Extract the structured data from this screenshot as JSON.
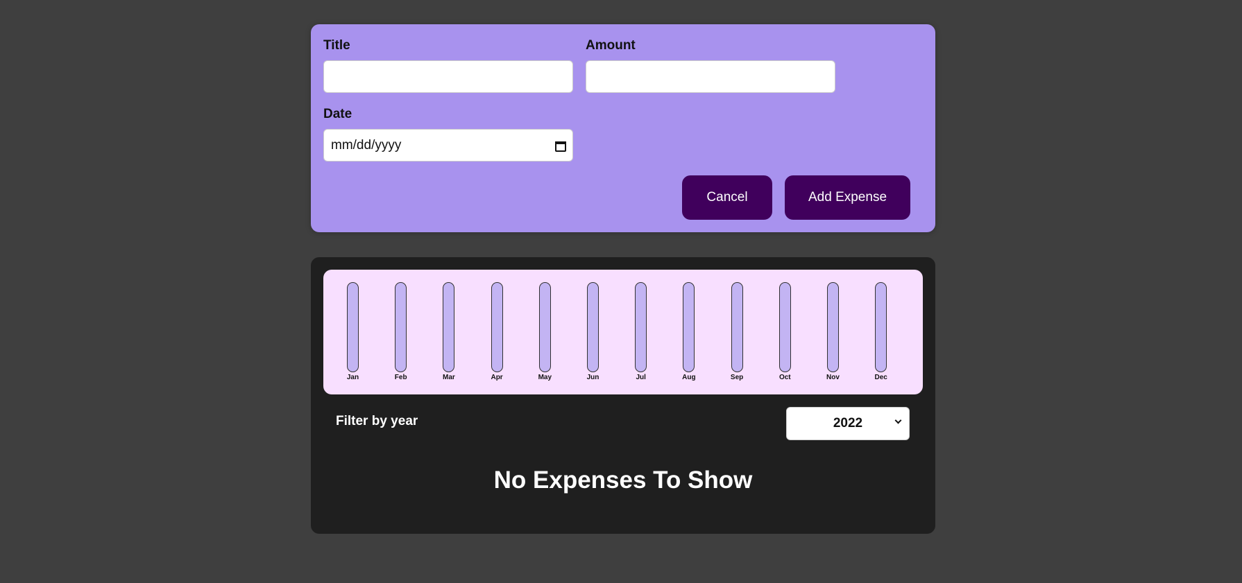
{
  "form": {
    "title_label": "Title",
    "title_value": "",
    "amount_label": "Amount",
    "amount_value": "",
    "date_label": "Date",
    "date_placeholder": "mm/dd/yyyy",
    "cancel_label": "Cancel",
    "add_label": "Add Expense"
  },
  "chart_data": {
    "type": "bar",
    "categories": [
      "Jan",
      "Feb",
      "Mar",
      "Apr",
      "May",
      "Jun",
      "Jul",
      "Aug",
      "Sep",
      "Oct",
      "Nov",
      "Dec"
    ],
    "values": [
      0,
      0,
      0,
      0,
      0,
      0,
      0,
      0,
      0,
      0,
      0,
      0
    ]
  },
  "filter": {
    "label": "Filter by year",
    "selected_year": "2022"
  },
  "expenses": {
    "empty_message": "No Expenses To Show"
  },
  "colors": {
    "page_bg": "#3f3f3f",
    "form_bg": "#a892ee",
    "button_bg": "#40005c",
    "card_bg": "#1f1f1f",
    "chart_bg": "#f8dfff",
    "bar_bg": "#c3b4f3"
  }
}
